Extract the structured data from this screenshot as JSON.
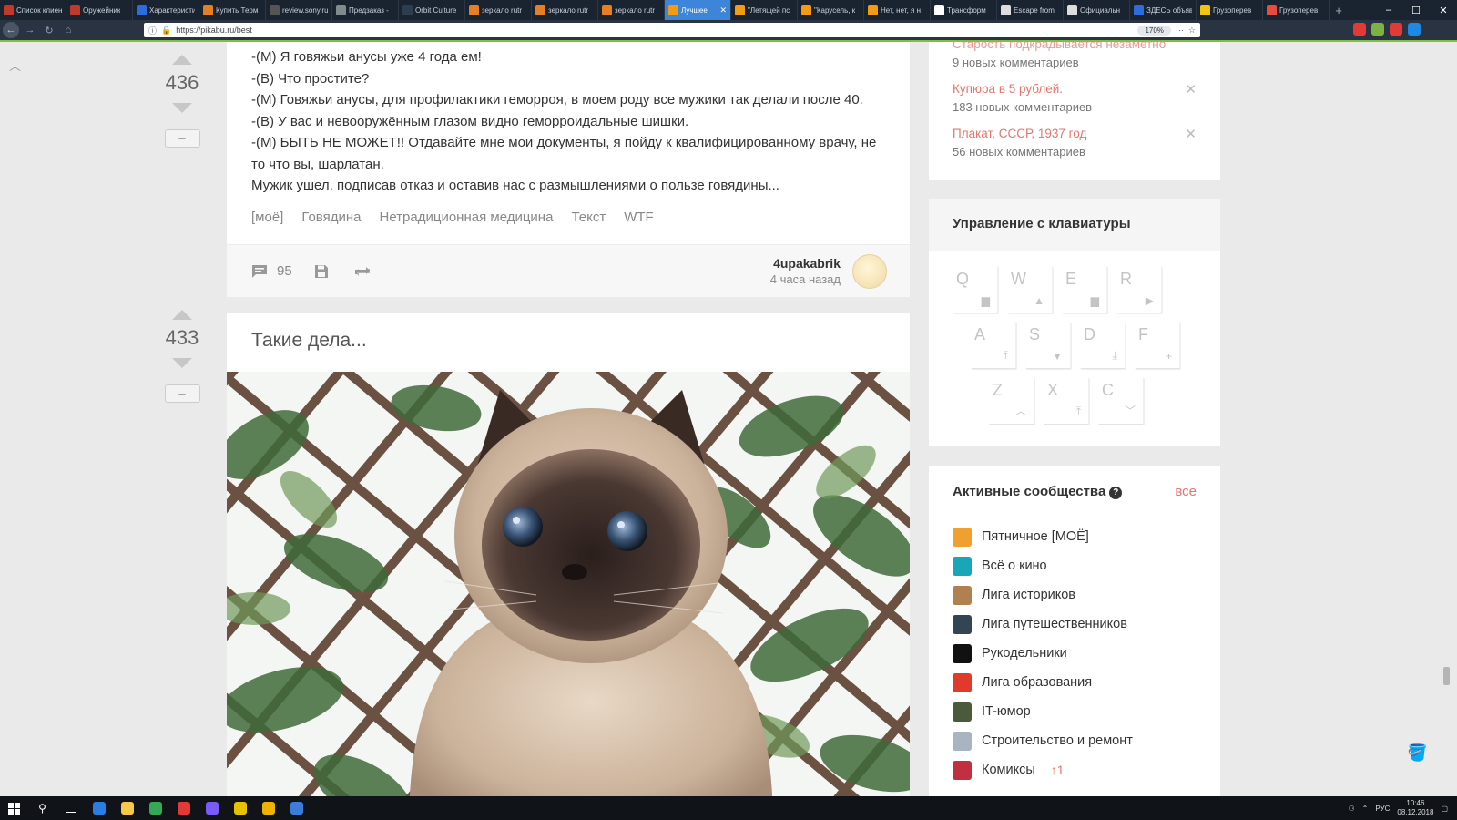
{
  "browser": {
    "tabs": [
      {
        "title": "Список клиен",
        "color": "#c0392b"
      },
      {
        "title": "Оружейник",
        "color": "#c0392b"
      },
      {
        "title": "Характеристи",
        "color": "#2d6cdf"
      },
      {
        "title": "Купить Терм",
        "color": "#e67e22"
      },
      {
        "title": "review.sony.ru/T",
        "color": "#555555"
      },
      {
        "title": "Предзаказ - ",
        "color": "#7f8c8d"
      },
      {
        "title": "Orbit Culture",
        "color": "#2c3e50"
      },
      {
        "title": "зеркало rutr",
        "color": "#e67e22"
      },
      {
        "title": "зеркало rutr",
        "color": "#e67e22"
      },
      {
        "title": "зеркало rutr",
        "color": "#e67e22"
      },
      {
        "title": "Лучшее",
        "color": "#f39c12",
        "active": true
      },
      {
        "title": "\"Летящей пс",
        "color": "#f39c12"
      },
      {
        "title": "\"Карусель, к",
        "color": "#f39c12"
      },
      {
        "title": "Нет, нет, я н",
        "color": "#f39c12"
      },
      {
        "title": "Трансформ",
        "color": "#ffffff"
      },
      {
        "title": "Escape from",
        "color": "#dddddd"
      },
      {
        "title": "Официальн",
        "color": "#dddddd"
      },
      {
        "title": "ЗДЕСЬ объяв",
        "color": "#2d6cdf"
      },
      {
        "title": "Грузоперев",
        "color": "#f1c40f"
      },
      {
        "title": "Грузоперев",
        "color": "#e74c3c"
      }
    ],
    "close_symbol": "✕",
    "new_tab": "+",
    "url": "https://pikabu.ru/best",
    "zoom": "170%",
    "window_controls": [
      "–",
      "☐",
      "✕"
    ]
  },
  "post1": {
    "rating": "436",
    "minus": "–",
    "lines": [
      "-(М) Я говяжьи анусы уже 4 года ем!",
      "-(В) Что простите?",
      "-(М) Говяжьи анусы, для профилактики геморроя, в моем роду все мужики так делали после 40.",
      "-(В) У вас и невооружённым глазом видно геморроидальные шишки.",
      "-(М) БЫТЬ НЕ МОЖЕТ!! Отдавайте мне мои документы, я пойду к квалифицированному врачу, не",
      "то что вы, шарлатан.",
      "Мужик ушел, подписав отказ и оставив нас с размышлениями о пользе говядины..."
    ],
    "tags": [
      "[моё]",
      "Говядина",
      "Нетрадиционная медицина",
      "Текст",
      "WTF"
    ],
    "comments_count": "95",
    "author": "4upakabrik",
    "time": "4 часа назад"
  },
  "post2": {
    "rating": "433",
    "minus": "–",
    "title": "Такие дела..."
  },
  "sidebar": {
    "hot": [
      {
        "title": "Старость подкрадывается незаметно",
        "comments": "9 новых комментариев"
      },
      {
        "title": "Купюра в 5 рублей.",
        "comments": "183 новых комментариев"
      },
      {
        "title": "Плакат, СССР, 1937 год",
        "comments": "56 новых комментариев"
      }
    ],
    "close_symbol": "✕",
    "keyboard_title": "Управление с клавиатуры",
    "keys": [
      {
        "letter": "Q",
        "icon": "comment-icon"
      },
      {
        "letter": "W",
        "icon": "arrow-up-icon"
      },
      {
        "letter": "E",
        "icon": "comment-icon"
      },
      {
        "letter": "R",
        "icon": "play-icon"
      },
      {
        "letter": "A",
        "icon": "to-top-icon"
      },
      {
        "letter": "S",
        "icon": "arrow-down-icon"
      },
      {
        "letter": "D",
        "icon": "download-icon"
      },
      {
        "letter": "F",
        "icon": "plus-icon"
      },
      {
        "letter": "Z",
        "icon": "chevron-up-icon"
      },
      {
        "letter": "X",
        "icon": "to-top-icon"
      },
      {
        "letter": "C",
        "icon": "chevron-down-icon"
      }
    ],
    "communities_title": "Активные сообщества",
    "communities_help": "?",
    "communities_all": "все",
    "communities": [
      {
        "name": "Пятничное [МОЁ]",
        "color": "#f0a030"
      },
      {
        "name": "Всё о кино",
        "color": "#19a7b8"
      },
      {
        "name": "Лига историков",
        "color": "#b08050"
      },
      {
        "name": "Лига путешественников",
        "color": "#334455"
      },
      {
        "name": "Рукодельники",
        "color": "#111111"
      },
      {
        "name": "Лига образования",
        "color": "#e03a2a"
      },
      {
        "name": "IT-юмор",
        "color": "#4a5a3a"
      },
      {
        "name": "Строительство и ремонт",
        "color": "#a8b4c0"
      },
      {
        "name": "Комиксы",
        "color": "#c03040",
        "badge": "↑1"
      }
    ]
  },
  "taskbar": {
    "lang": "РУС",
    "time": "10:46",
    "date": "08.12.2018",
    "apps": [
      "#2a7de1",
      "#f7c948",
      "#35a853",
      "#e53935",
      "#7a5af8",
      "#e8c200",
      "#f0b400",
      "#3b7dd8"
    ]
  }
}
